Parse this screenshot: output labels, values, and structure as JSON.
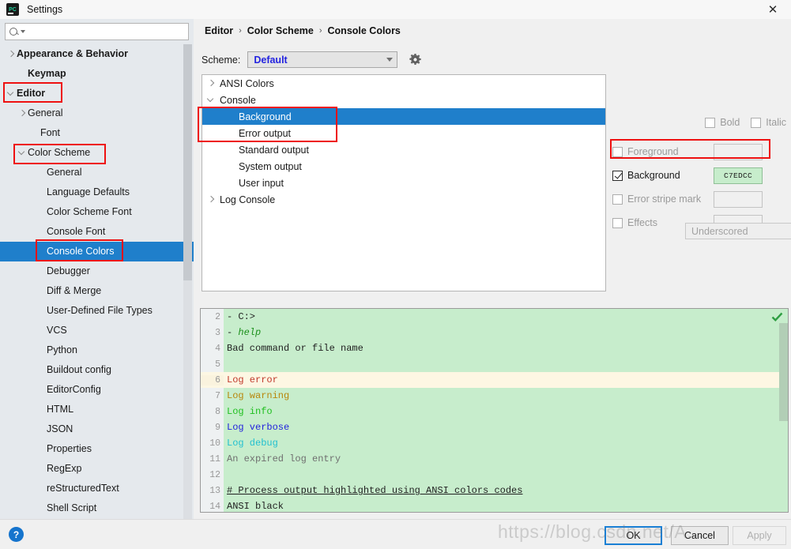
{
  "window": {
    "title": "Settings",
    "logo_text": "PC",
    "close_label": "✕"
  },
  "search": {
    "value": "",
    "placeholder": ""
  },
  "sidebar": {
    "items": [
      {
        "label": "Appearance & Behavior",
        "indent": 0,
        "arrow": "right",
        "bold": true,
        "selected": false,
        "highlighted": false
      },
      {
        "label": "Keymap",
        "indent": 1,
        "arrow": "none",
        "bold": true,
        "selected": false,
        "highlighted": false
      },
      {
        "label": "Editor",
        "indent": 0,
        "arrow": "down",
        "bold": true,
        "selected": false,
        "highlighted": true
      },
      {
        "label": "General",
        "indent": 1,
        "arrow": "right",
        "bold": false,
        "selected": false,
        "highlighted": false
      },
      {
        "label": "Font",
        "indent": 2,
        "arrow": "none",
        "bold": false,
        "selected": false,
        "highlighted": false
      },
      {
        "label": "Color Scheme",
        "indent": 1,
        "arrow": "down",
        "bold": false,
        "selected": false,
        "highlighted": true
      },
      {
        "label": "General",
        "indent": 3,
        "arrow": "none",
        "bold": false,
        "selected": false,
        "highlighted": false
      },
      {
        "label": "Language Defaults",
        "indent": 3,
        "arrow": "none",
        "bold": false,
        "selected": false,
        "highlighted": false
      },
      {
        "label": "Color Scheme Font",
        "indent": 3,
        "arrow": "none",
        "bold": false,
        "selected": false,
        "highlighted": false
      },
      {
        "label": "Console Font",
        "indent": 3,
        "arrow": "none",
        "bold": false,
        "selected": false,
        "highlighted": false
      },
      {
        "label": "Console Colors",
        "indent": 3,
        "arrow": "none",
        "bold": false,
        "selected": true,
        "highlighted": true
      },
      {
        "label": "Debugger",
        "indent": 3,
        "arrow": "none",
        "bold": false,
        "selected": false,
        "highlighted": false
      },
      {
        "label": "Diff & Merge",
        "indent": 3,
        "arrow": "none",
        "bold": false,
        "selected": false,
        "highlighted": false
      },
      {
        "label": "User-Defined File Types",
        "indent": 3,
        "arrow": "none",
        "bold": false,
        "selected": false,
        "highlighted": false
      },
      {
        "label": "VCS",
        "indent": 3,
        "arrow": "none",
        "bold": false,
        "selected": false,
        "highlighted": false
      },
      {
        "label": "Python",
        "indent": 3,
        "arrow": "none",
        "bold": false,
        "selected": false,
        "highlighted": false
      },
      {
        "label": "Buildout config",
        "indent": 3,
        "arrow": "none",
        "bold": false,
        "selected": false,
        "highlighted": false
      },
      {
        "label": "EditorConfig",
        "indent": 3,
        "arrow": "none",
        "bold": false,
        "selected": false,
        "highlighted": false
      },
      {
        "label": "HTML",
        "indent": 3,
        "arrow": "none",
        "bold": false,
        "selected": false,
        "highlighted": false
      },
      {
        "label": "JSON",
        "indent": 3,
        "arrow": "none",
        "bold": false,
        "selected": false,
        "highlighted": false
      },
      {
        "label": "Properties",
        "indent": 3,
        "arrow": "none",
        "bold": false,
        "selected": false,
        "highlighted": false
      },
      {
        "label": "RegExp",
        "indent": 3,
        "arrow": "none",
        "bold": false,
        "selected": false,
        "highlighted": false
      },
      {
        "label": "reStructuredText",
        "indent": 3,
        "arrow": "none",
        "bold": false,
        "selected": false,
        "highlighted": false
      },
      {
        "label": "Shell Script",
        "indent": 3,
        "arrow": "none",
        "bold": false,
        "selected": false,
        "highlighted": false
      }
    ]
  },
  "breadcrumb": {
    "items": [
      "Editor",
      "Color Scheme",
      "Console Colors"
    ],
    "separator": "›"
  },
  "scheme": {
    "label": "Scheme:",
    "value": "Default",
    "gear_icon": "gear-icon"
  },
  "options": {
    "rows": [
      {
        "label": "ANSI Colors",
        "indent": 0,
        "arrow": "right",
        "selected": false
      },
      {
        "label": "Console",
        "indent": 0,
        "arrow": "down",
        "selected": false
      },
      {
        "label": "Background",
        "indent": 1,
        "arrow": "none",
        "selected": true
      },
      {
        "label": "Error output",
        "indent": 1,
        "arrow": "none",
        "selected": false
      },
      {
        "label": "Standard output",
        "indent": 1,
        "arrow": "none",
        "selected": false
      },
      {
        "label": "System output",
        "indent": 1,
        "arrow": "none",
        "selected": false
      },
      {
        "label": "User input",
        "indent": 1,
        "arrow": "none",
        "selected": false
      },
      {
        "label": "Log Console",
        "indent": 0,
        "arrow": "right",
        "selected": false
      }
    ]
  },
  "attributes": {
    "bold": {
      "label": "Bold",
      "checked": false,
      "enabled": false
    },
    "italic": {
      "label": "Italic",
      "checked": false,
      "enabled": false
    },
    "foreground": {
      "label": "Foreground",
      "checked": false,
      "enabled": false,
      "value": "",
      "swatch": ""
    },
    "background": {
      "label": "Background",
      "checked": true,
      "enabled": true,
      "value": "C7EDCC",
      "swatch": "#c7edcc"
    },
    "error_stripe_mark": {
      "label": "Error stripe mark",
      "checked": false,
      "enabled": false,
      "value": "",
      "swatch": ""
    },
    "effects": {
      "label": "Effects",
      "checked": false,
      "enabled": false,
      "value": "",
      "swatch": ""
    },
    "effect_type": {
      "value": "Underscored",
      "enabled": false
    }
  },
  "preview": {
    "background_color": "#c7edcc",
    "caret_row_color": "#fdf7e3",
    "lines": [
      {
        "num": "2",
        "segments": [
          {
            "text": "- C:>",
            "color": "#222222",
            "style": "normal"
          }
        ],
        "highlight": false
      },
      {
        "num": "3",
        "segments": [
          {
            "text": "- ",
            "color": "#222222",
            "style": "normal"
          },
          {
            "text": "help",
            "color": "#1a8f1a",
            "style": "italic"
          }
        ],
        "highlight": false
      },
      {
        "num": "4",
        "segments": [
          {
            "text": "Bad command or file name",
            "color": "#222222",
            "style": "normal"
          }
        ],
        "highlight": false
      },
      {
        "num": "5",
        "segments": [
          {
            "text": "",
            "color": "#222222",
            "style": "normal"
          }
        ],
        "highlight": false
      },
      {
        "num": "6",
        "segments": [
          {
            "text": "Log error",
            "color": "#c0392b",
            "style": "normal"
          }
        ],
        "highlight": true
      },
      {
        "num": "7",
        "segments": [
          {
            "text": "Log warning",
            "color": "#b8860b",
            "style": "normal"
          }
        ],
        "highlight": false
      },
      {
        "num": "8",
        "segments": [
          {
            "text": "Log info",
            "color": "#1fbf1f",
            "style": "normal"
          }
        ],
        "highlight": false
      },
      {
        "num": "9",
        "segments": [
          {
            "text": "Log verbose",
            "color": "#2222dd",
            "style": "normal"
          }
        ],
        "highlight": false
      },
      {
        "num": "10",
        "segments": [
          {
            "text": "Log debug",
            "color": "#22c0d0",
            "style": "normal"
          }
        ],
        "highlight": false
      },
      {
        "num": "11",
        "segments": [
          {
            "text": "An expired log entry",
            "color": "#6f6f6f",
            "style": "normal"
          }
        ],
        "highlight": false
      },
      {
        "num": "12",
        "segments": [
          {
            "text": "",
            "color": "#222222",
            "style": "normal"
          }
        ],
        "highlight": false
      },
      {
        "num": "13",
        "segments": [
          {
            "text": "# Process output highlighted using ANSI colors codes",
            "color": "#222222",
            "style": "underline"
          }
        ],
        "highlight": false
      },
      {
        "num": "14",
        "segments": [
          {
            "text": "ANSI black",
            "color": "#222222",
            "style": "normal"
          }
        ],
        "highlight": false
      }
    ],
    "check_icon": "checkmark-icon"
  },
  "footer": {
    "help_label": "?",
    "ok_label": "OK",
    "cancel_label": "Cancel",
    "apply_label": "Apply"
  },
  "watermark": {
    "text": "https://blog.csdn.net/A..."
  },
  "colors": {
    "selection_blue": "#1f7fcb",
    "annotation_red": "#ee1111",
    "console_background": "#c7edcc",
    "scheme_value_blue": "#2323e0"
  }
}
